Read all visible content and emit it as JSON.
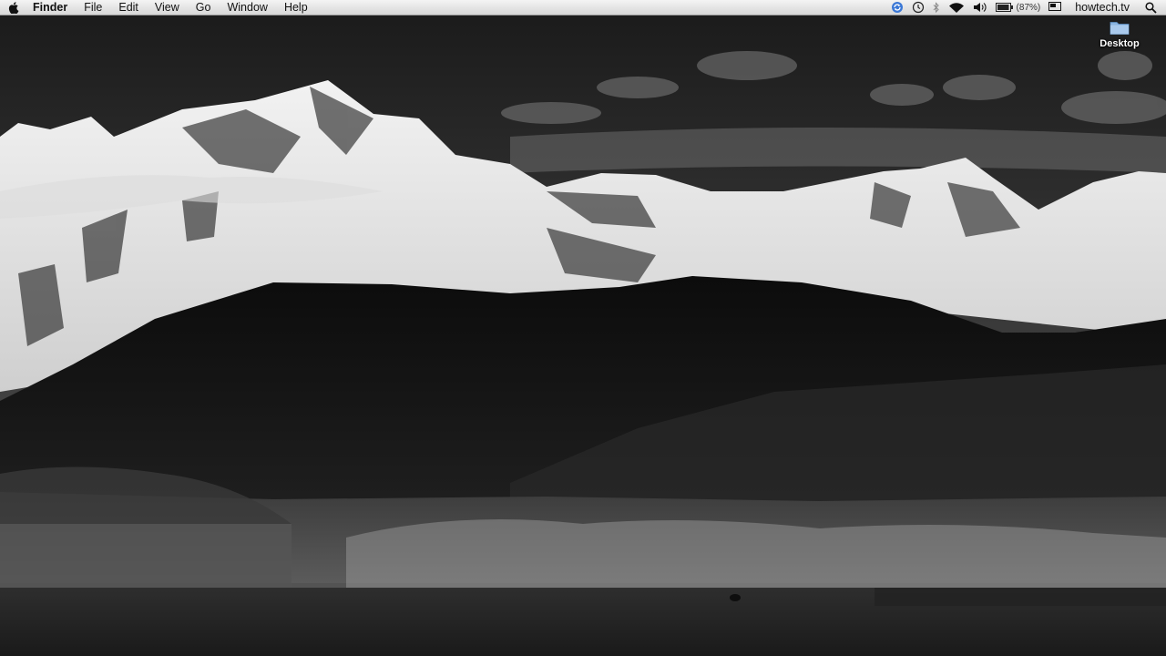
{
  "menubar": {
    "app_name": "Finder",
    "items": [
      "File",
      "Edit",
      "View",
      "Go",
      "Window",
      "Help"
    ],
    "status": {
      "icons": [
        "sync-icon",
        "time-machine-icon",
        "bluetooth-icon",
        "wifi-icon",
        "volume-icon",
        "battery-icon",
        "display-icon",
        "spotlight-icon"
      ],
      "battery_percent": "(87%)",
      "user": "howtech.tv"
    }
  },
  "desktop": {
    "icons": [
      {
        "label": "Desktop",
        "icon": "folder-icon"
      }
    ]
  }
}
